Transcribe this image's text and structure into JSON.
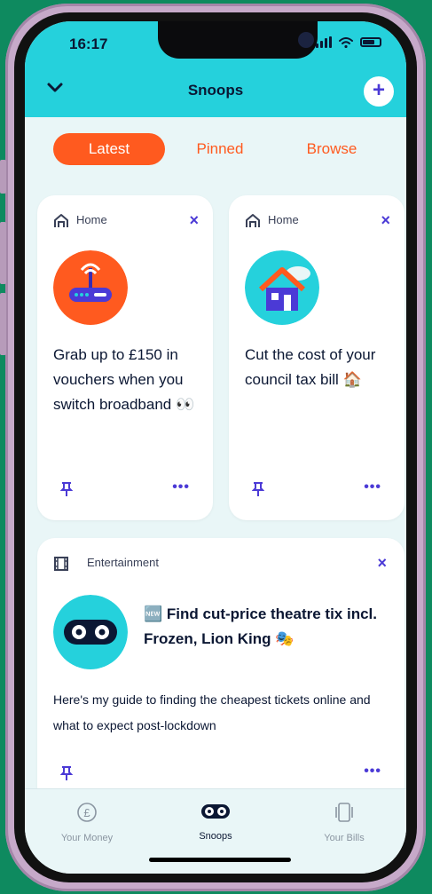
{
  "status": {
    "time": "16:17"
  },
  "header": {
    "title": "Snoops",
    "add_label": "+"
  },
  "tabs": [
    {
      "label": "Latest",
      "active": true
    },
    {
      "label": "Pinned",
      "active": false
    },
    {
      "label": "Browse",
      "active": false
    }
  ],
  "cards": [
    {
      "category": "Home",
      "icon": "router-icon",
      "text": "Grab up to £150 in vouchers when you switch broadband 👀",
      "close": "×",
      "more": "•••"
    },
    {
      "category": "Home",
      "icon": "house-icon",
      "text": "Cut the cost of your council tax bill 🏠",
      "close": "×",
      "more": "•••"
    },
    {
      "category": "Entertainment",
      "icon": "snoop-eyes-icon",
      "headline": "🆕 Find cut-price theatre tix incl. Frozen, Lion King 🎭",
      "body": "Here's my guide to finding the cheapest tickets online and what to expect post-lockdown",
      "close": "×",
      "more": "•••"
    }
  ],
  "bottom_nav": [
    {
      "label": "Your Money",
      "icon": "pound-coin-icon",
      "active": false
    },
    {
      "label": "Snoops",
      "icon": "snoop-eyes-icon",
      "active": true
    },
    {
      "label": "Your Bills",
      "icon": "bills-icon",
      "active": false
    }
  ],
  "colors": {
    "accent_orange": "#ff5a1f",
    "header_cyan": "#25d1dc",
    "brand_purple": "#4b3ad6",
    "background_green": "#0e8a5f"
  }
}
